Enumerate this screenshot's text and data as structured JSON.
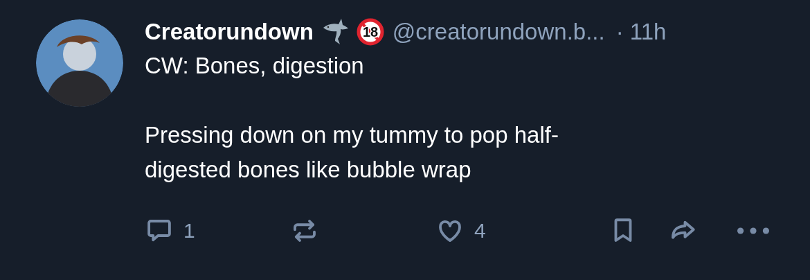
{
  "post": {
    "author": {
      "name": "Creatorundown",
      "badges": [
        {
          "kind": "shark"
        },
        {
          "kind": "age-restricted",
          "label": "18"
        }
      ],
      "handle": "@creatorundown.b...",
      "separator": "·",
      "time": "11h"
    },
    "paragraphs": [
      "CW: Bones, digestion",
      "Pressing down on my tummy to pop half-digested bones like bubble wrap"
    ],
    "actions": [
      {
        "kind": "reply",
        "count": "1"
      },
      {
        "kind": "repost"
      },
      {
        "kind": "like",
        "count": "4"
      },
      {
        "kind": "bookmark"
      },
      {
        "kind": "share"
      },
      {
        "kind": "more"
      }
    ]
  }
}
